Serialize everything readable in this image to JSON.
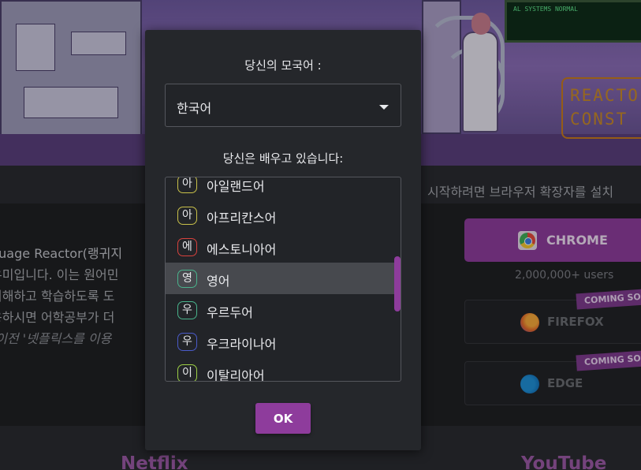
{
  "hero": {
    "screen_lines": [
      "AL SYSTEMS NORMAL"
    ],
    "sign_lines": [
      "REACTO",
      "CONST"
    ]
  },
  "page": {
    "install_text": "시작하려면 브라우저 확장자를 설치",
    "desc_lines": [
      "guage Reactor(랭귀지",
      "우미입니다. 이는 원어민",
      "이해하고 학습하도록 도",
      "용하시면 어학공부가 더",
      "(이전 '넷플릭스를 이용"
    ],
    "chrome_label": "CHROME",
    "chrome_users": "2,000,000+ users",
    "firefox_label": "FIREFOX",
    "edge_label": "EDGE",
    "coming_soon": "COMING SOO",
    "footer_left": "Netflix",
    "footer_right": "YouTube"
  },
  "modal": {
    "native_label": "당신의 모국어 :",
    "native_value": "한국어",
    "learning_label": "당신은 배우고 있습니다:",
    "ok_label": "OK",
    "languages": [
      {
        "badge": "아",
        "name": "아일랜드어",
        "color": "#c9c14a",
        "selected": false
      },
      {
        "badge": "아",
        "name": "아프리칸스어",
        "color": "#c9c14a",
        "selected": false
      },
      {
        "badge": "에",
        "name": "에스토니아어",
        "color": "#d8423d",
        "selected": false
      },
      {
        "badge": "영",
        "name": "영어",
        "color": "#49b38c",
        "selected": true
      },
      {
        "badge": "우",
        "name": "우르두어",
        "color": "#49b38c",
        "selected": false
      },
      {
        "badge": "우",
        "name": "우크라이나어",
        "color": "#4a5bc9",
        "selected": false
      },
      {
        "badge": "이",
        "name": "이탈리아어",
        "color": "#9ccf45",
        "selected": false
      }
    ]
  },
  "colors": {
    "accent": "#8e3c9c",
    "background": "#1f2023",
    "modal": "#25272b"
  }
}
